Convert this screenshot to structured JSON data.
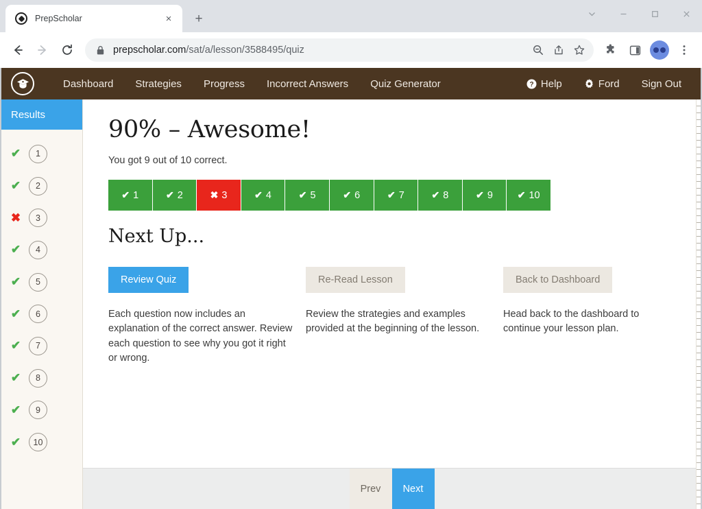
{
  "browser": {
    "tab": {
      "title": "PrepScholar",
      "close_label": "×",
      "favicon": "prepscholar-favicon"
    },
    "new_tab_label": "+",
    "window_controls": {
      "minimize_group": "chevron-down",
      "minimize": "–",
      "maximize": "□",
      "close": "✕"
    },
    "nav": {
      "back": "←",
      "forward": "→",
      "reload": "↻"
    },
    "omnibox": {
      "host": "prepscholar.com",
      "path": "/sat/a/lesson/3588495/quiz",
      "full_url": "prepscholar.com/sat/a/lesson/3588495/quiz",
      "lock_icon": "lock-icon"
    },
    "toolbar_icons": [
      "zoom-out-icon",
      "share-icon",
      "bookmark-star-icon",
      "extensions-puzzle-icon",
      "side-panel-icon",
      "profile-avatar-icon",
      "chrome-menu-icon"
    ]
  },
  "site_nav": {
    "logo": "graduation-cap-logo",
    "links": [
      "Dashboard",
      "Strategies",
      "Progress",
      "Incorrect Answers",
      "Quiz Generator"
    ],
    "right": [
      {
        "label": "Help",
        "icon": "help-circle-icon"
      },
      {
        "label": "Ford",
        "icon": "gear-icon"
      },
      {
        "label": "Sign Out",
        "icon": ""
      }
    ]
  },
  "sidebar": {
    "heading": "Results",
    "items": [
      {
        "number": "1",
        "mark": "✔",
        "correct": true
      },
      {
        "number": "2",
        "mark": "✔",
        "correct": true
      },
      {
        "number": "3",
        "mark": "✖",
        "correct": false
      },
      {
        "number": "4",
        "mark": "✔",
        "correct": true
      },
      {
        "number": "5",
        "mark": "✔",
        "correct": true
      },
      {
        "number": "6",
        "mark": "✔",
        "correct": true
      },
      {
        "number": "7",
        "mark": "✔",
        "correct": true
      },
      {
        "number": "8",
        "mark": "✔",
        "correct": true
      },
      {
        "number": "9",
        "mark": "✔",
        "correct": true
      },
      {
        "number": "10",
        "mark": "✔",
        "correct": true
      }
    ]
  },
  "main": {
    "score_title": "90% – Awesome!",
    "score_subtitle": "You got 9 out of 10 correct.",
    "question_boxes": [
      {
        "number": "1",
        "mark": "✔",
        "correct": true
      },
      {
        "number": "2",
        "mark": "✔",
        "correct": true
      },
      {
        "number": "3",
        "mark": "✖",
        "correct": false
      },
      {
        "number": "4",
        "mark": "✔",
        "correct": true
      },
      {
        "number": "5",
        "mark": "✔",
        "correct": true
      },
      {
        "number": "6",
        "mark": "✔",
        "correct": true
      },
      {
        "number": "7",
        "mark": "✔",
        "correct": true
      },
      {
        "number": "8",
        "mark": "✔",
        "correct": true
      },
      {
        "number": "9",
        "mark": "✔",
        "correct": true
      },
      {
        "number": "10",
        "mark": "✔",
        "correct": true
      }
    ],
    "next_up_heading": "Next Up...",
    "cards": [
      {
        "button": "Review Quiz",
        "style": "primary",
        "text": "Each question now includes an explanation of the correct answer. Review each question to see why you got it right or wrong."
      },
      {
        "button": "Re-Read Lesson",
        "style": "secondary",
        "text": "Review the strategies and examples provided at the beginning of the lesson."
      },
      {
        "button": "Back to Dashboard",
        "style": "secondary",
        "text": "Head back to the dashboard to continue your lesson plan."
      }
    ]
  },
  "footer": {
    "prev_label": "Prev",
    "next_label": "Next"
  },
  "colors": {
    "brand_brown": "#4b3621",
    "accent_blue": "#3aa3e8",
    "correct_green": "#3ba03b",
    "wrong_red": "#e8261c",
    "sidebar_bg": "#faf7f2",
    "button_muted": "#ece8e1"
  }
}
